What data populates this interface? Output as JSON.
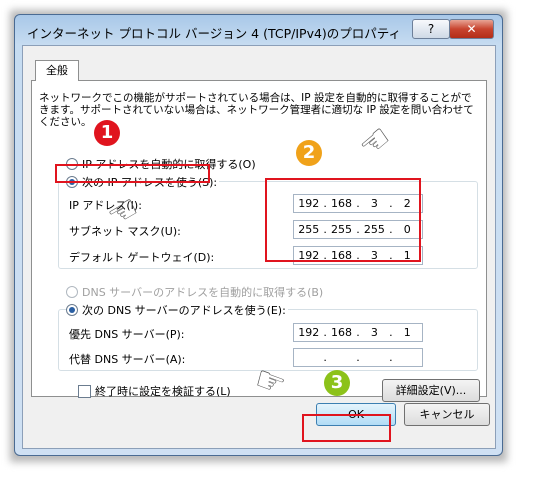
{
  "window": {
    "title": "インターネット プロトコル バージョン 4 (TCP/IPv4)のプロパティ",
    "help_label": "?",
    "close_label": "✕"
  },
  "tab": {
    "label": "全般"
  },
  "description": "ネットワークでこの機能がサポートされている場合は、IP 設定を自動的に取得することができます。サポートされていない場合は、ネットワーク管理者に適切な IP 設定を問い合わせてください。",
  "ip_section": {
    "auto_label": "IP アドレスを自動的に取得する(O)",
    "manual_label": "次の IP アドレスを使う(S):",
    "fields": [
      {
        "label": "IP アドレス(I):",
        "octets": [
          "192",
          "168",
          "3",
          "2"
        ]
      },
      {
        "label": "サブネット マスク(U):",
        "octets": [
          "255",
          "255",
          "255",
          "0"
        ]
      },
      {
        "label": "デフォルト ゲートウェイ(D):",
        "octets": [
          "192",
          "168",
          "3",
          "1"
        ]
      }
    ]
  },
  "dns_section": {
    "auto_label": "DNS サーバーのアドレスを自動的に取得する(B)",
    "manual_label": "次の DNS サーバーのアドレスを使う(E):",
    "fields": [
      {
        "label": "優先 DNS サーバー(P):",
        "octets": [
          "192",
          "168",
          "3",
          "1"
        ]
      },
      {
        "label": "代替 DNS サーバー(A):",
        "octets": [
          "",
          "",
          "",
          ""
        ]
      }
    ]
  },
  "validate_label": "終了時に設定を検証する(L)",
  "advanced_label": "詳細設定(V)...",
  "ok_label": "OK",
  "cancel_label": "キャンセル",
  "annotations": {
    "step1": "1",
    "step2": "2",
    "step3": "3"
  },
  "colors": {
    "highlight": "#e0141e",
    "badge_red": "#e0141e",
    "badge_orange": "#f0a21a",
    "badge_green": "#8cc21a"
  }
}
